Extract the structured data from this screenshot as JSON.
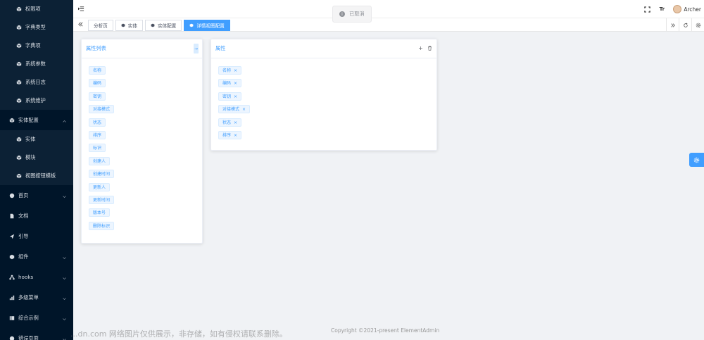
{
  "sidebar": {
    "items": [
      {
        "label": "权限项",
        "type": "sub",
        "icon": "cube-icon"
      },
      {
        "label": "字典类型",
        "type": "sub",
        "icon": "cube-icon"
      },
      {
        "label": "字典项",
        "type": "sub",
        "icon": "cube-icon"
      },
      {
        "label": "系统参数",
        "type": "sub",
        "icon": "cube-icon"
      },
      {
        "label": "系统日志",
        "type": "sub",
        "icon": "cube-icon"
      },
      {
        "label": "系统维护",
        "type": "sub",
        "icon": "cube-icon"
      },
      {
        "label": "实体配置",
        "type": "top-open",
        "icon": "cube-icon"
      },
      {
        "label": "实体",
        "type": "sub",
        "icon": "cube-icon"
      },
      {
        "label": "模块",
        "type": "sub",
        "icon": "cube-icon"
      },
      {
        "label": "视图按钮模板",
        "type": "sub",
        "icon": "cube-icon"
      },
      {
        "label": "首页",
        "type": "top",
        "icon": "dashboard-icon"
      },
      {
        "label": "文档",
        "type": "top-noarrow",
        "icon": "document-icon"
      },
      {
        "label": "引导",
        "type": "top-noarrow",
        "icon": "send-icon"
      },
      {
        "label": "组件",
        "type": "top",
        "icon": "component-icon"
      },
      {
        "label": "hooks",
        "type": "top",
        "icon": "tree-icon"
      },
      {
        "label": "多级菜单",
        "type": "top",
        "icon": "chart-icon"
      },
      {
        "label": "综合示例",
        "type": "top",
        "icon": "example-icon"
      },
      {
        "label": "错误页面",
        "type": "top",
        "icon": "error-icon"
      }
    ]
  },
  "header": {
    "font_size_icon_text": "Tr",
    "username": "Archer"
  },
  "toast": {
    "text": "已取消"
  },
  "tabs": [
    {
      "label": "分析页",
      "icon": false,
      "active": false
    },
    {
      "label": "实体",
      "icon": true,
      "active": false
    },
    {
      "label": "实体配置",
      "icon": true,
      "active": false
    },
    {
      "label": "详情视图配置",
      "icon": true,
      "active": true
    }
  ],
  "attribute_list_card": {
    "title": "属性列表",
    "expand_label": "→",
    "items": [
      "名称",
      "编码",
      "密钥",
      "对接模式",
      "状态",
      "排序",
      "标识",
      "创建人",
      "创建时间",
      "更新人",
      "更新时间",
      "版本号",
      "删除标识"
    ]
  },
  "attribute_card": {
    "title": "属性",
    "add_label": "+",
    "delete_label": "🗑",
    "close_label": "×",
    "items": [
      "名称",
      "编码",
      "密钥",
      "对接模式",
      "状态",
      "排序"
    ]
  },
  "footer": {
    "copyright": "Copyright ©2021-present ElementAdmin"
  },
  "watermark": {
    "text": "...dn.com 网络图片仅供展示，非存储，如有侵权请联系删除。"
  },
  "colors": {
    "primary": "#409eff",
    "sidebar_bg": "#001529",
    "sidebar_sub_bg": "#0c2135"
  }
}
